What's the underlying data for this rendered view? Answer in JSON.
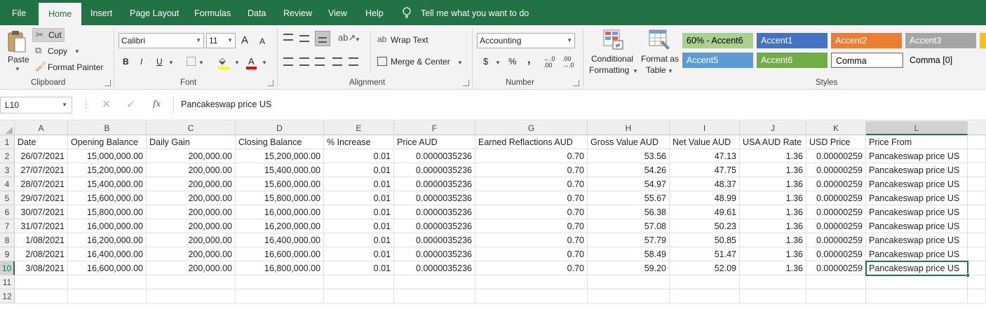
{
  "tabs": {
    "file": "File",
    "home": "Home",
    "insert": "Insert",
    "page_layout": "Page Layout",
    "formulas": "Formulas",
    "data": "Data",
    "review": "Review",
    "view": "View",
    "help": "Help",
    "tell_me": "Tell me what you want to do"
  },
  "ribbon": {
    "clipboard": {
      "paste": "Paste",
      "cut": "Cut",
      "copy": "Copy",
      "format_painter": "Format Painter",
      "label": "Clipboard"
    },
    "font": {
      "name": "Calibri",
      "size": "11",
      "grow": "A",
      "shrink": "A",
      "bold": "B",
      "italic": "I",
      "underline": "U",
      "font_color_letter": "A",
      "label": "Font"
    },
    "alignment": {
      "wrap_text": "Wrap Text",
      "merge_center": "Merge & Center",
      "label": "Alignment"
    },
    "number": {
      "format": "Accounting",
      "currency": "$",
      "percent": "%",
      "comma": ",",
      "inc_decimal": "←.0 .00",
      "dec_decimal": ".00 →.0",
      "label": "Number"
    },
    "styles": {
      "conditional_formatting_1": "Conditional",
      "conditional_formatting_2": "Formatting",
      "format_as_table_1": "Format as",
      "format_as_table_2": "Table",
      "cells": [
        "60% - Accent6",
        "Accent1",
        "Accent2",
        "Accent3",
        "Accent5",
        "Accent6",
        "Comma",
        "Comma [0]"
      ],
      "label": "Styles"
    }
  },
  "formula_bar": {
    "name_box": "L10",
    "fx": "fx",
    "content": "Pancakeswap price US"
  },
  "sheet": {
    "columns": [
      "A",
      "B",
      "C",
      "D",
      "E",
      "F",
      "G",
      "H",
      "I",
      "J",
      "K",
      "L"
    ],
    "row_numbers": [
      "1",
      "2",
      "3",
      "4",
      "5",
      "6",
      "7",
      "8",
      "9",
      "10",
      "11",
      "12"
    ],
    "selected_cell": "L10",
    "headers": [
      "Date",
      "Opening Balance",
      "Daily Gain",
      "Closing Balance",
      "% Increase",
      "Price AUD",
      "Earned Reflactions AUD",
      "Gross Value AUD",
      "Net Value AUD",
      "USA AUD Rate",
      "USD Price",
      "Price From"
    ],
    "rows": [
      [
        "26/07/2021",
        "15,000,000.00",
        "200,000.00",
        "15,200,000.00",
        "0.01",
        "0.0000035236",
        "0.70",
        "53.56",
        "47.13",
        "1.36",
        "0.00000259",
        "Pancakeswap price US"
      ],
      [
        "27/07/2021",
        "15,200,000.00",
        "200,000.00",
        "15,400,000.00",
        "0.01",
        "0.0000035236",
        "0.70",
        "54.26",
        "47.75",
        "1.36",
        "0.00000259",
        "Pancakeswap price US"
      ],
      [
        "28/07/2021",
        "15,400,000.00",
        "200,000.00",
        "15,600,000.00",
        "0.01",
        "0.0000035236",
        "0.70",
        "54.97",
        "48.37",
        "1.36",
        "0.00000259",
        "Pancakeswap price US"
      ],
      [
        "29/07/2021",
        "15,600,000.00",
        "200,000.00",
        "15,800,000.00",
        "0.01",
        "0.0000035236",
        "0.70",
        "55.67",
        "48.99",
        "1.36",
        "0.00000259",
        "Pancakeswap price US"
      ],
      [
        "30/07/2021",
        "15,800,000.00",
        "200,000.00",
        "16,000,000.00",
        "0.01",
        "0.0000035236",
        "0.70",
        "56.38",
        "49.61",
        "1.36",
        "0.00000259",
        "Pancakeswap price US"
      ],
      [
        "31/07/2021",
        "16,000,000.00",
        "200,000.00",
        "16,200,000.00",
        "0.01",
        "0.0000035236",
        "0.70",
        "57.08",
        "50.23",
        "1.36",
        "0.00000259",
        "Pancakeswap price US"
      ],
      [
        "1/08/2021",
        "16,200,000.00",
        "200,000.00",
        "16,400,000.00",
        "0.01",
        "0.0000035236",
        "0.70",
        "57.79",
        "50.85",
        "1.36",
        "0.00000259",
        "Pancakeswap price US"
      ],
      [
        "2/08/2021",
        "16,400,000.00",
        "200,000.00",
        "16,600,000.00",
        "0.01",
        "0.0000035236",
        "0.70",
        "58.49",
        "51.47",
        "1.36",
        "0.00000259",
        "Pancakeswap price US"
      ],
      [
        "3/08/2021",
        "16,600,000.00",
        "200,000.00",
        "16,800,000.00",
        "0.01",
        "0.0000035236",
        "0.70",
        "59.20",
        "52.09",
        "1.36",
        "0.00000259",
        "Pancakeswap price US"
      ]
    ]
  },
  "colors": {
    "accent": "#217346",
    "style_accent6_60": "#a9d08e",
    "style_accent1": "#4472c4",
    "style_accent2": "#ed7d31",
    "style_accent3": "#a5a5a5",
    "style_accent5": "#5b9bd5",
    "style_accent6": "#70ad47"
  }
}
